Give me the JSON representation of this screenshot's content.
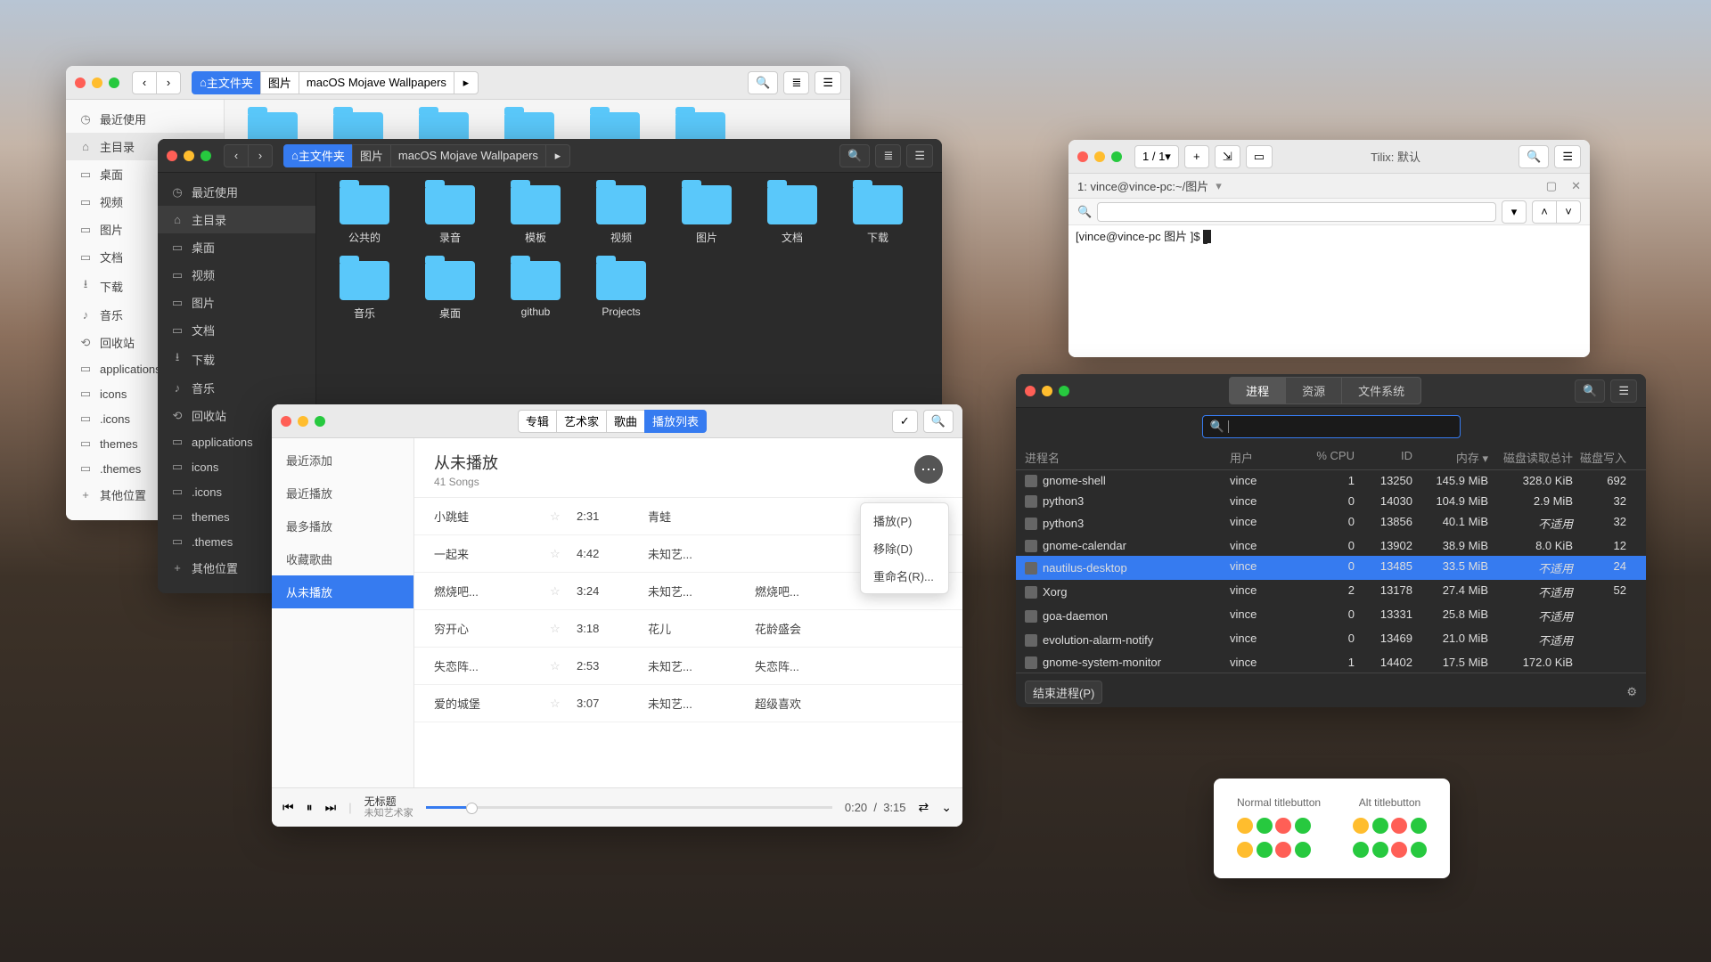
{
  "nautilus_light": {
    "path_home": "主文件夹",
    "crumb1": "图片",
    "crumb2": "macOS Mojave Wallpapers",
    "sidebar": [
      "最近使用",
      "主目录",
      "桌面",
      "视频",
      "图片",
      "文档",
      "下载",
      "音乐",
      "回收站",
      "applications",
      "icons",
      ".icons",
      "themes",
      ".themes",
      "其他位置"
    ],
    "icons": [
      "◷",
      "⌂",
      "▭",
      "▭",
      "▭",
      "▭",
      "⭳",
      "♪",
      "⟲",
      "▭",
      "▭",
      "▭",
      "▭",
      "▭",
      "+"
    ]
  },
  "nautilus_dark": {
    "path_home": "主文件夹",
    "crumb1": "图片",
    "crumb2": "macOS Mojave Wallpapers",
    "sidebar": [
      "最近使用",
      "主目录",
      "桌面",
      "视频",
      "图片",
      "文档",
      "下载",
      "音乐",
      "回收站",
      "applications",
      "icons",
      ".icons",
      "themes",
      ".themes",
      "其他位置"
    ],
    "icons": [
      "◷",
      "⌂",
      "▭",
      "▭",
      "▭",
      "▭",
      "⭳",
      "♪",
      "⟲",
      "▭",
      "▭",
      "▭",
      "▭",
      "▭",
      "+"
    ],
    "folders": [
      "公共的",
      "录音",
      "模板",
      "视频",
      "图片",
      "文档",
      "下载",
      "音乐",
      "桌面",
      "github",
      "Projects"
    ]
  },
  "music": {
    "tabs": [
      "专辑",
      "艺术家",
      "歌曲",
      "播放列表"
    ],
    "sidebar": [
      "最近添加",
      "最近播放",
      "最多播放",
      "收藏歌曲",
      "从未播放"
    ],
    "title": "从未播放",
    "subtitle": "41 Songs",
    "tracks": [
      {
        "t": "小跳蛙",
        "d": "2:31",
        "a": "青蛙",
        "al": ""
      },
      {
        "t": "一起来",
        "d": "4:42",
        "a": "未知艺...",
        "al": ""
      },
      {
        "t": "燃烧吧...",
        "d": "3:24",
        "a": "未知艺...",
        "al": "燃烧吧..."
      },
      {
        "t": "穷开心",
        "d": "3:18",
        "a": "花儿",
        "al": "花龄盛会"
      },
      {
        "t": "失恋阵...",
        "d": "2:53",
        "a": "未知艺...",
        "al": "失恋阵..."
      },
      {
        "t": "爱的城堡",
        "d": "3:07",
        "a": "未知艺...",
        "al": "超级喜欢"
      }
    ],
    "ctx": [
      "播放(P)",
      "移除(D)",
      "重命名(R)..."
    ],
    "np_title": "无标题",
    "np_artist": "未知艺术家",
    "time": "0:20  /  3:15"
  },
  "tilix": {
    "counter": "1 / 1",
    "title": "Tilix: 默认",
    "tab": "1: vince@vince-pc:~/图片",
    "prompt": "[vince@vince-pc 图片 ]$ "
  },
  "sysmon": {
    "tabs": [
      "进程",
      "资源",
      "文件系统"
    ],
    "cols": [
      "进程名",
      "用户",
      "% CPU",
      "ID",
      "内存",
      "磁盘读取总计",
      "磁盘写入"
    ],
    "rows": [
      {
        "n": "gnome-shell",
        "u": "vince",
        "c": "1",
        "id": "13250",
        "m": "145.9 MiB",
        "dr": "328.0 KiB",
        "dw": "692"
      },
      {
        "n": "python3",
        "u": "vince",
        "c": "0",
        "id": "14030",
        "m": "104.9 MiB",
        "dr": "2.9 MiB",
        "dw": "32"
      },
      {
        "n": "python3",
        "u": "vince",
        "c": "0",
        "id": "13856",
        "m": "40.1 MiB",
        "dr": "不适用",
        "dw": "32"
      },
      {
        "n": "gnome-calendar",
        "u": "vince",
        "c": "0",
        "id": "13902",
        "m": "38.9 MiB",
        "dr": "8.0 KiB",
        "dw": "12"
      },
      {
        "n": "nautilus-desktop",
        "u": "vince",
        "c": "0",
        "id": "13485",
        "m": "33.5 MiB",
        "dr": "不适用",
        "dw": "24",
        "sel": true
      },
      {
        "n": "Xorg",
        "u": "vince",
        "c": "2",
        "id": "13178",
        "m": "27.4 MiB",
        "dr": "不适用",
        "dw": "52"
      },
      {
        "n": "goa-daemon",
        "u": "vince",
        "c": "0",
        "id": "13331",
        "m": "25.8 MiB",
        "dr": "不适用",
        "dw": ""
      },
      {
        "n": "evolution-alarm-notify",
        "u": "vince",
        "c": "0",
        "id": "13469",
        "m": "21.0 MiB",
        "dr": "不适用",
        "dw": ""
      },
      {
        "n": "gnome-system-monitor",
        "u": "vince",
        "c": "1",
        "id": "14402",
        "m": "17.5 MiB",
        "dr": "172.0 KiB",
        "dw": ""
      }
    ],
    "end_btn": "结束进程(P)"
  },
  "demo": {
    "h1": "Normal titlebutton",
    "h2": "Alt titlebutton"
  }
}
